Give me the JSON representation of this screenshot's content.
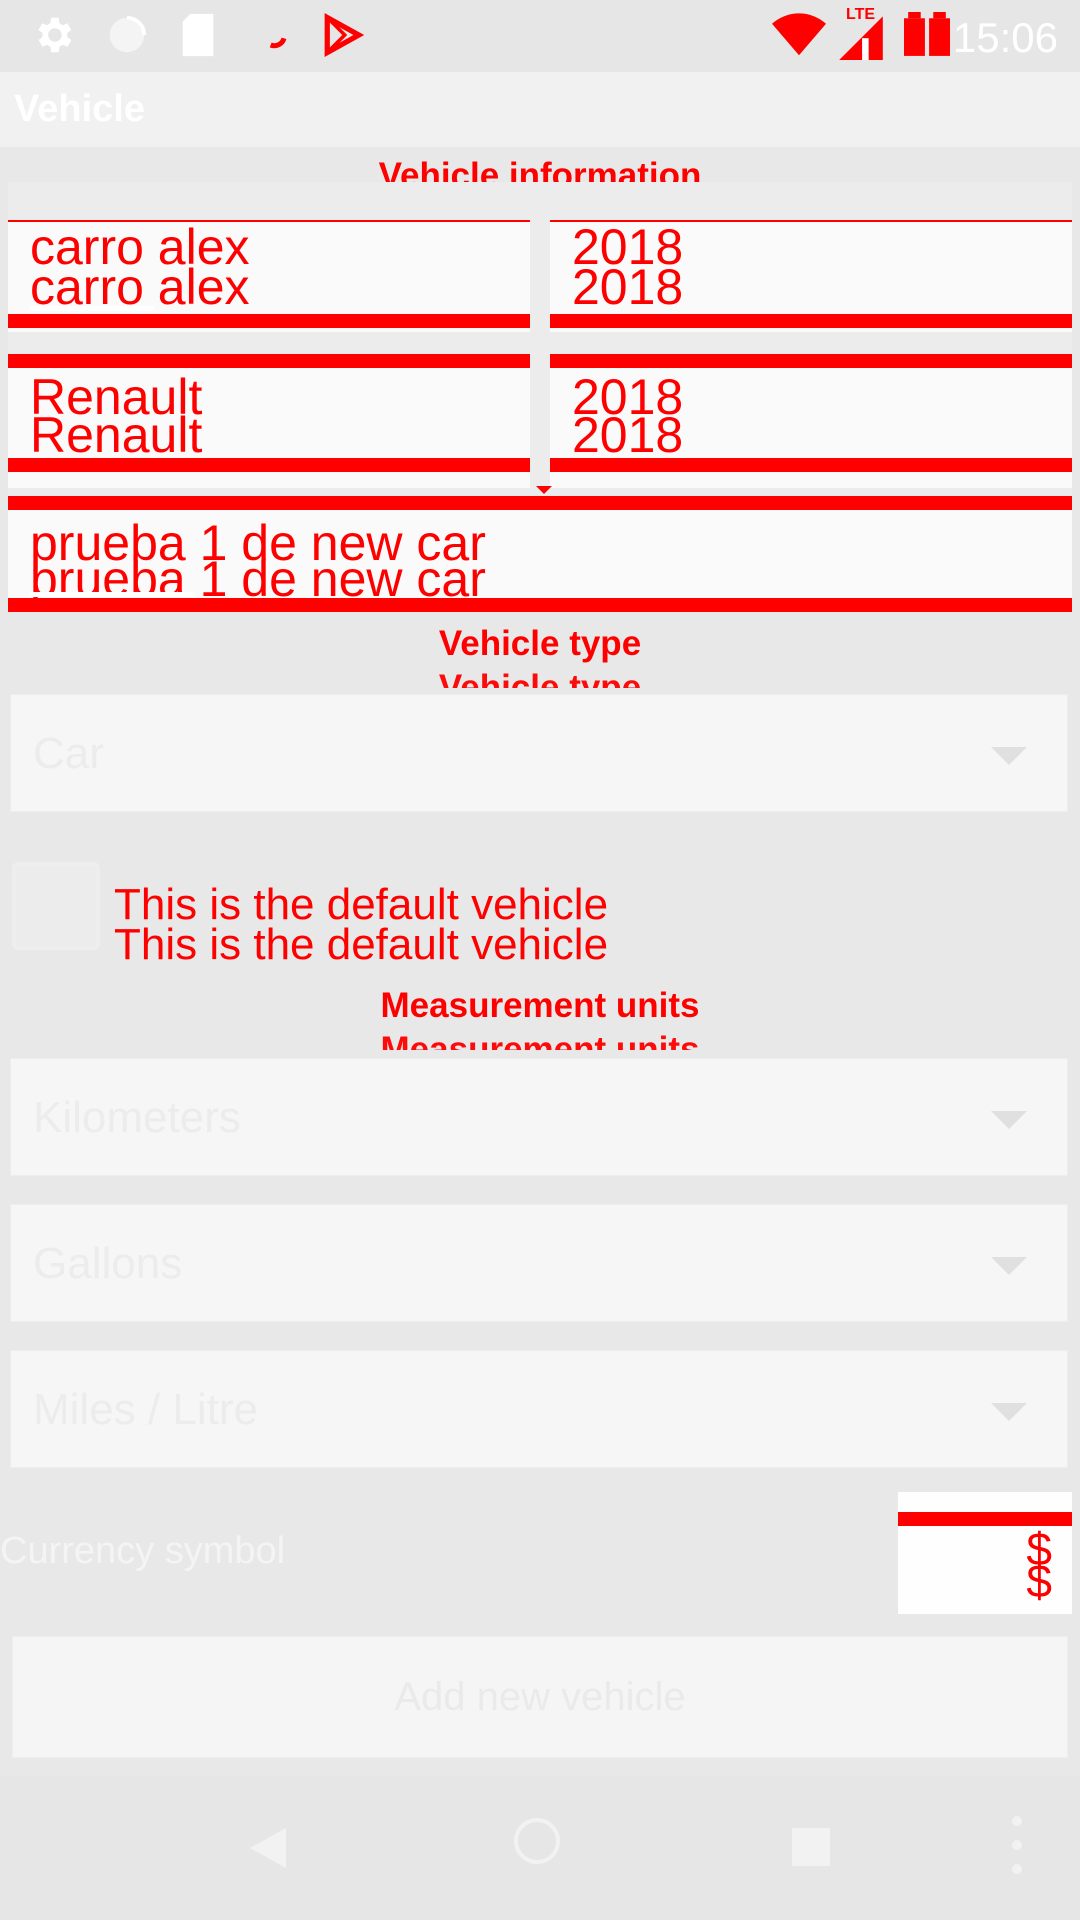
{
  "status_bar": {
    "time": "15:06",
    "network_label": "LTE",
    "icons": [
      "settings-icon",
      "sync-icon",
      "sd-card-icon",
      "loading-icon",
      "play-store-icon",
      "wifi-icon",
      "signal-icon",
      "battery-icon"
    ]
  },
  "app_bar": {
    "title": "Vehicle"
  },
  "vehicle_information": {
    "title": "Vehicle information",
    "name": "carro alex",
    "year": "2018",
    "make": "Renault",
    "model_year": "2018",
    "model": "prueba 1 de new car"
  },
  "vehicle_type": {
    "title": "Vehicle type",
    "selected": "Car"
  },
  "default_vehicle": {
    "label": "This is the default vehicle",
    "checked": false
  },
  "measurement_units": {
    "title": "Measurement units",
    "distance": "Kilometers",
    "volume": "Gallons",
    "consumption": "Miles / Litre"
  },
  "currency": {
    "label": "Currency symbol",
    "symbol": "$"
  },
  "actions": {
    "add_label": "Add new vehicle"
  },
  "colors": {
    "accent": "#ff0000",
    "background": "#e8e8e8"
  }
}
